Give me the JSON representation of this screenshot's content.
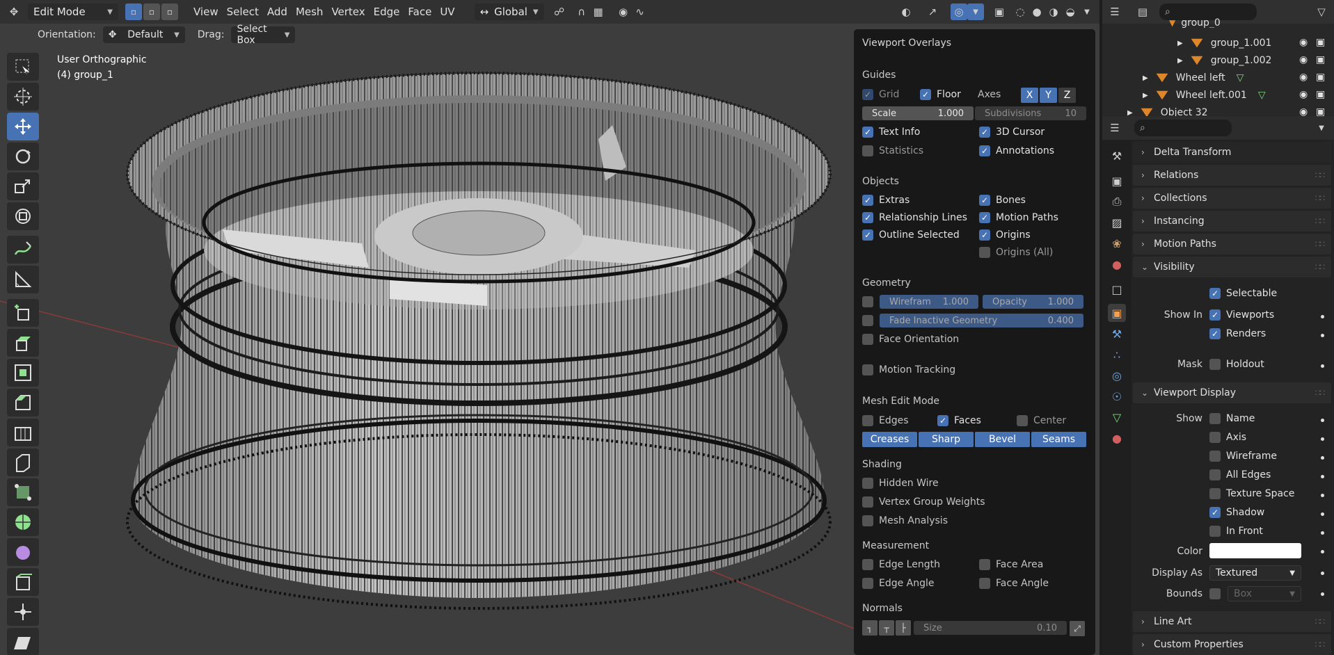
{
  "header": {
    "mode": "Edit Mode",
    "menus": [
      "View",
      "Select",
      "Add",
      "Mesh",
      "Vertex",
      "Edge",
      "Face",
      "UV"
    ],
    "transform_orientation": "Global"
  },
  "subheader": {
    "orientation_label": "Orientation:",
    "orientation_value": "Default",
    "drag_label": "Drag:",
    "drag_value": "Select Box"
  },
  "viewport": {
    "view_name": "User Orthographic",
    "object_info": "(4) group_1"
  },
  "overlays": {
    "title": "Viewport Overlays",
    "guides": {
      "heading": "Guides",
      "grid": "Grid",
      "floor": "Floor",
      "axes": "Axes",
      "axis_x": "X",
      "axis_y": "Y",
      "axis_z": "Z",
      "scale_label": "Scale",
      "scale_value": "1.000",
      "subdiv_label": "Subdivisions",
      "subdiv_value": "10",
      "text_info": "Text Info",
      "cursor_3d": "3D Cursor",
      "statistics": "Statistics",
      "annotations": "Annotations"
    },
    "objects": {
      "heading": "Objects",
      "extras": "Extras",
      "bones": "Bones",
      "relationship_lines": "Relationship Lines",
      "motion_paths": "Motion Paths",
      "outline_selected": "Outline Selected",
      "origins": "Origins",
      "origins_all": "Origins (All)"
    },
    "geometry": {
      "heading": "Geometry",
      "wireframe_label": "Wirefram",
      "wireframe_value": "1.000",
      "opacity_label": "Opacity",
      "opacity_value": "1.000",
      "fade_label": "Fade Inactive Geometry",
      "fade_value": "0.400",
      "face_orientation": "Face Orientation"
    },
    "motion_tracking": "Motion Tracking",
    "mesh_edit": {
      "heading": "Mesh Edit Mode",
      "edges": "Edges",
      "faces": "Faces",
      "center": "Center",
      "buttons": [
        "Creases",
        "Sharp",
        "Bevel",
        "Seams"
      ]
    },
    "shading": {
      "heading": "Shading",
      "hidden_wire": "Hidden Wire",
      "vertex_group_weights": "Vertex Group Weights",
      "mesh_analysis": "Mesh Analysis"
    },
    "measurement": {
      "heading": "Measurement",
      "edge_length": "Edge Length",
      "face_area": "Face Area",
      "edge_angle": "Edge Angle",
      "face_angle": "Face Angle"
    },
    "normals": {
      "heading": "Normals",
      "size_label": "Size",
      "size_value": "0.10"
    }
  },
  "outliner": {
    "rows": [
      "group_0",
      "group_1.001",
      "group_1.002",
      "Wheel left",
      "Wheel left.001",
      "Object 32"
    ]
  },
  "properties": {
    "panels": {
      "delta_transform": "Delta Transform",
      "relations": "Relations",
      "collections": "Collections",
      "instancing": "Instancing",
      "motion_paths": "Motion Paths",
      "visibility": "Visibility",
      "viewport_display": "Viewport Display",
      "line_art": "Line Art",
      "custom_properties": "Custom Properties"
    },
    "visibility": {
      "selectable": "Selectable",
      "show_in": "Show In",
      "viewports": "Viewports",
      "renders": "Renders",
      "mask": "Mask",
      "holdout": "Holdout"
    },
    "viewport_display": {
      "show": "Show",
      "name": "Name",
      "axis": "Axis",
      "wireframe": "Wireframe",
      "all_edges": "All Edges",
      "texture_space": "Texture Space",
      "shadow": "Shadow",
      "in_front": "In Front",
      "color_label": "Color",
      "color_value": "#ffffff",
      "display_as_label": "Display As",
      "display_as_value": "Textured",
      "bounds_label": "Bounds",
      "bounds_value": "Box"
    }
  }
}
